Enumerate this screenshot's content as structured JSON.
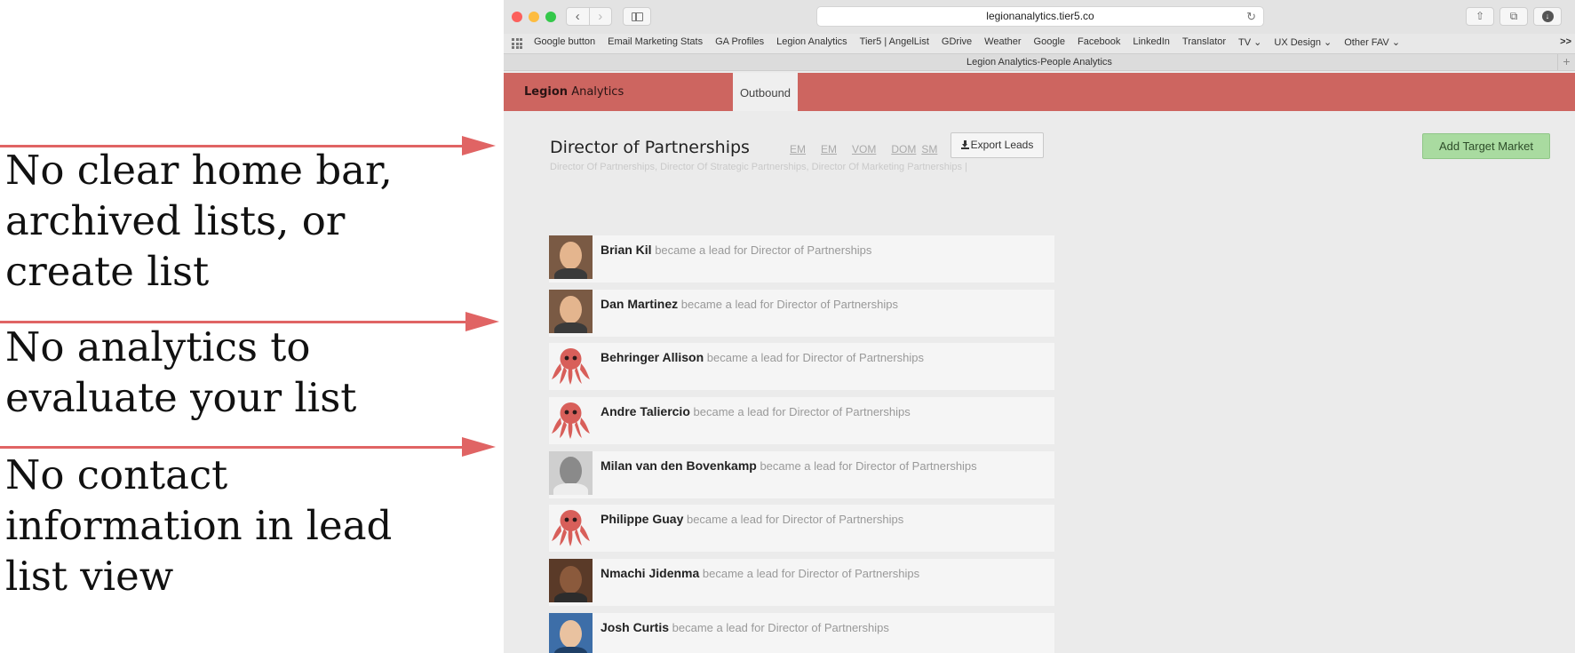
{
  "annotations": [
    {
      "lines": [
        "No clear home bar,",
        "archived lists, or",
        "create list"
      ]
    },
    {
      "lines": [
        "No analytics to",
        "evaluate your list"
      ]
    },
    {
      "lines": [
        "No contact",
        "information in lead",
        "list view"
      ]
    }
  ],
  "colors": {
    "annotation_arrow": "#e06464",
    "app_bar": "#cd6560",
    "add_button": "#a9dba0"
  },
  "browser": {
    "url": "legionanalytics.tier5.co",
    "tab_title": "Legion Analytics-People Analytics",
    "bookmarks": [
      "Google button",
      "Email Marketing Stats",
      "GA Profiles",
      "Legion Analytics",
      "Tier5 | AngelList",
      "GDrive",
      "Weather",
      "Google",
      "Facebook",
      "LinkedIn",
      "Translator",
      "TV ⌄",
      "UX Design ⌄",
      "Other FAV ⌄"
    ],
    "bookmarks_more": ">>"
  },
  "app": {
    "brand_bold": "Legion",
    "brand_light": " Analytics",
    "nav_tab": "Outbound",
    "page_title": "Director of Partnerships",
    "quick_links": [
      "EM",
      "EM",
      "VOM",
      "DOM",
      "SM"
    ],
    "export_label": "Export Leads",
    "add_label": "Add Target Market",
    "subtitle": "Director Of Partnerships, Director Of Strategic Partnerships, Director Of Marketing Partnerships |",
    "leads": [
      {
        "name": "Brian Kil",
        "text": " became a lead for Director of Partnerships",
        "avatar": "photo"
      },
      {
        "name": "Dan Martinez",
        "text": " became a lead for Director of Partnerships",
        "avatar": "photo"
      },
      {
        "name": "Behringer Allison",
        "text": " became a lead for Director of Partnerships",
        "avatar": "octo"
      },
      {
        "name": "Andre Taliercio",
        "text": " became a lead for Director of Partnerships",
        "avatar": "octo"
      },
      {
        "name": "Milan van den Bovenkamp",
        "text": " became a lead for Director of Partnerships",
        "avatar": "bw"
      },
      {
        "name": "Philippe Guay",
        "text": " became a lead for Director of Partnerships",
        "avatar": "octo"
      },
      {
        "name": "Nmachi Jidenma",
        "text": " became a lead for Director of Partnerships",
        "avatar": "dark"
      },
      {
        "name": "Josh Curtis",
        "text": " became a lead for Director of Partnerships",
        "avatar": "blue"
      }
    ]
  }
}
